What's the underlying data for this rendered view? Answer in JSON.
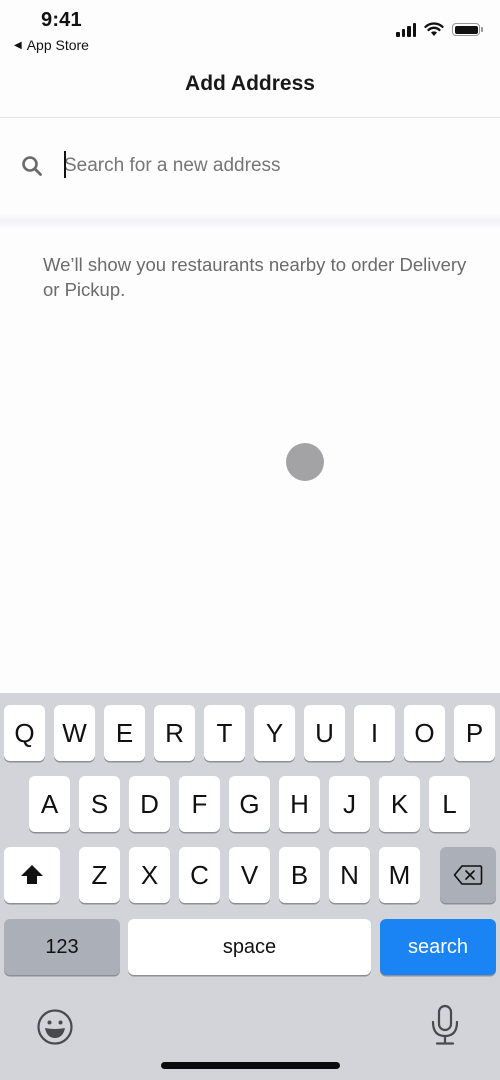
{
  "status_bar": {
    "time": "9:41",
    "back_app": "App Store",
    "back_icon": "triangle-left-icon",
    "icons": [
      "signal-icon",
      "wifi-icon",
      "battery-icon"
    ]
  },
  "nav": {
    "title": "Add Address"
  },
  "search": {
    "icon": "search-icon",
    "placeholder": "Search for a new address",
    "value": ""
  },
  "hint": {
    "text": "We’ll show you restaurants nearby to order Delivery or Pickup."
  },
  "keyboard": {
    "rows": [
      [
        "Q",
        "W",
        "E",
        "R",
        "T",
        "Y",
        "U",
        "I",
        "O",
        "P"
      ],
      [
        "A",
        "S",
        "D",
        "F",
        "G",
        "H",
        "J",
        "K",
        "L"
      ],
      [
        "Z",
        "X",
        "C",
        "V",
        "B",
        "N",
        "M"
      ]
    ],
    "shift_icon": "shift-arrow-icon",
    "delete_icon": "backspace-icon",
    "numbers_label": "123",
    "space_label": "space",
    "search_label": "search",
    "emoji_icon": "emoji-icon",
    "mic_icon": "microphone-icon",
    "accent_color": "#1a84f5"
  }
}
